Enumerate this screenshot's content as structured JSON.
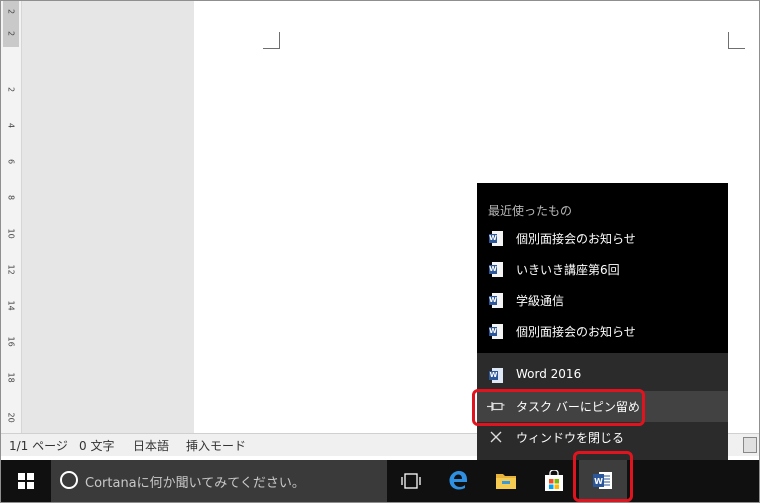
{
  "ruler": {
    "numbers": [
      "2",
      "2",
      "2",
      "4",
      "6",
      "8",
      "10",
      "12",
      "14",
      "16",
      "18",
      "20"
    ]
  },
  "statusbar": {
    "page": "1/1 ページ",
    "words": "0 文字",
    "language": "日本語",
    "mode": "挿入モード"
  },
  "jumplist": {
    "header": "最近使ったもの",
    "recent": [
      "個別面接会のお知らせ",
      "いきいき講座第6回",
      "学級通信",
      "個別面接会のお知らせ"
    ],
    "app_name": "Word 2016",
    "pin": "タスク バーにピン留め",
    "close": "ウィンドウを閉じる"
  },
  "taskbar": {
    "search_placeholder": "Cortanaに何か聞いてみてください。",
    "apps": [
      "task-view",
      "edge",
      "file-explorer",
      "store",
      "word"
    ]
  },
  "colors": {
    "highlight": "#e0141f",
    "word_blue": "#2b579a",
    "taskbar": "#101010"
  }
}
